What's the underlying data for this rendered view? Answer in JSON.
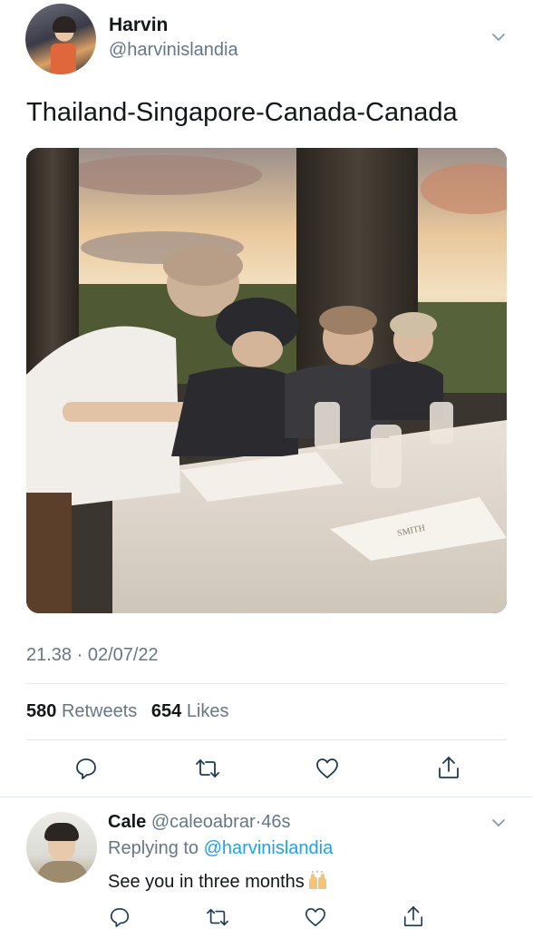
{
  "tweet": {
    "author_name": "Harvin",
    "author_handle": "@harvinislandia",
    "text": "Thailand-Singapore-Canada-Canada",
    "timestamp": "21.38 · 02/07/22",
    "retweets_count": "580",
    "retweets_label": "Retweets",
    "likes_count": "654",
    "likes_label": "Likes",
    "photo_placard_text": "SMITH"
  },
  "actions": {
    "icons": [
      "reply-icon",
      "retweet-icon",
      "like-icon",
      "share-icon"
    ]
  },
  "reply": {
    "author_name": "Cale",
    "author_handle": "@caleoabrar",
    "time_ago": "46s",
    "replying_prefix": "Replying to",
    "replying_to": "@harvinislandia",
    "text": "See you in three months"
  },
  "colors": {
    "text_primary": "#14171a",
    "text_secondary": "#657786",
    "link": "#1da1f2",
    "divider": "#e1e8ed"
  }
}
